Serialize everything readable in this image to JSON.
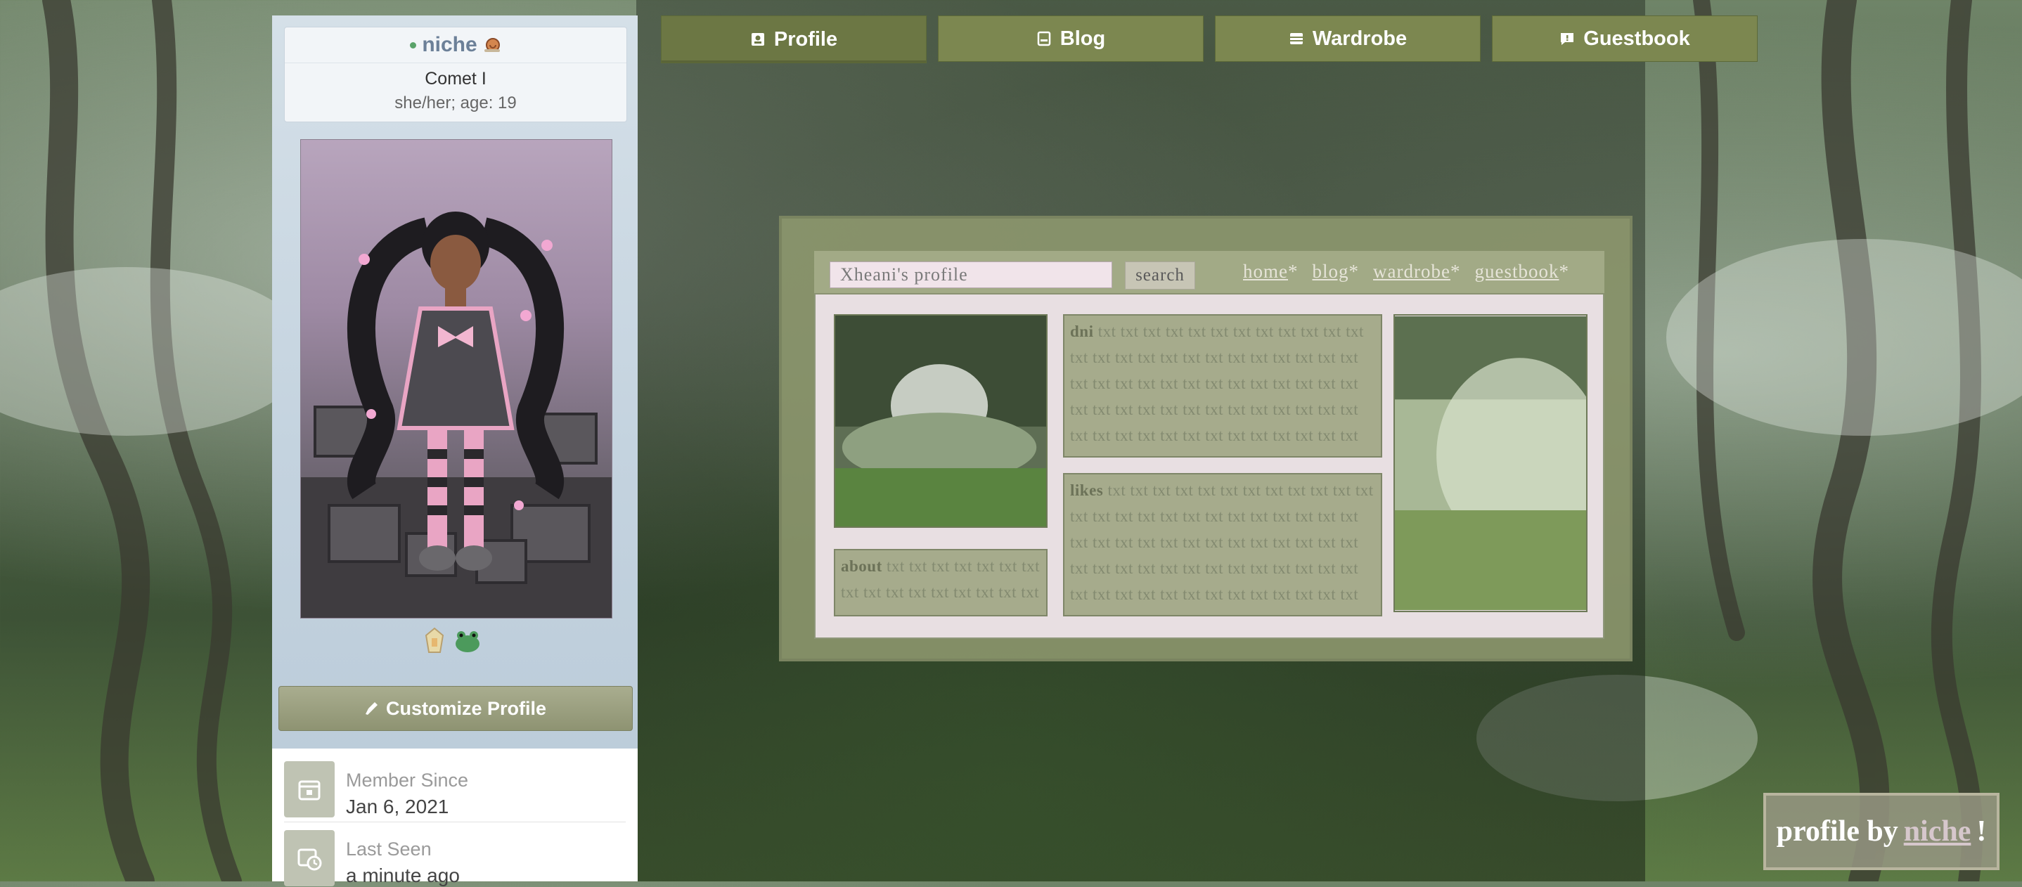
{
  "sidebar": {
    "username": "niche",
    "display_name": "Comet I",
    "pronouns": "she/her; age: 19",
    "customize_label": "Customize Profile",
    "stats": [
      {
        "label": "Member Since",
        "value": "Jan 6, 2021"
      },
      {
        "label": "Last Seen",
        "value": "a minute ago"
      }
    ]
  },
  "tabs": [
    {
      "label": "Profile",
      "icon": "profile-icon"
    },
    {
      "label": "Blog",
      "icon": "blog-icon"
    },
    {
      "label": "Wardrobe",
      "icon": "wardrobe-icon"
    },
    {
      "label": "Guestbook",
      "icon": "guestbook-icon"
    }
  ],
  "widget": {
    "search_placeholder": "Xheani's profile",
    "search_button": "search",
    "nav": [
      "home",
      "blog",
      "wardrobe",
      "guestbook"
    ],
    "nav_suffix": "*",
    "about_title": "about",
    "about_text": "txt txt txt txt txt txt txt txt txt txt txt txt txt txt txt txt",
    "dni_title": "dni",
    "dni_text": "txt txt txt txt txt txt txt txt txt txt txt txt txt txt txt txt txt txt txt txt txt txt txt txt txt txt txt txt txt txt txt txt txt txt txt txt txt txt txt txt txt txt txt txt txt txt txt txt txt txt txt txt txt txt txt txt txt txt txt txt txt txt txt txt txt txt txt",
    "likes_title": "likes",
    "likes_text": "txt txt txt txt txt txt txt txt txt txt txt txt txt txt txt txt txt txt txt txt txt txt txt txt txt txt txt txt txt txt txt txt txt txt txt txt txt txt txt txt txt txt txt txt txt txt txt txt txt txt txt txt txt txt txt txt txt txt txt txt txt txt txt txt txt txt txt txt txt"
  },
  "credit": {
    "prefix": "profile by",
    "link": "niche",
    "suffix": "!"
  },
  "colors": {
    "accent": "#7c8750",
    "sidebar": "#c4d3df",
    "panel": "#a6ab8c"
  }
}
